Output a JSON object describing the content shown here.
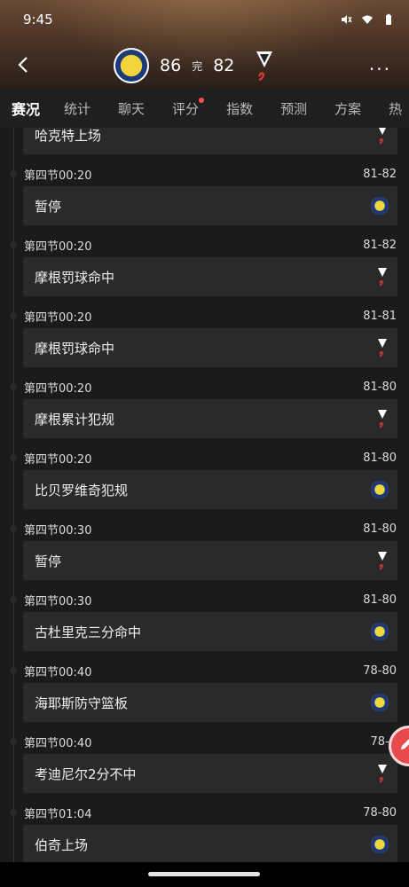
{
  "status_bar": {
    "time": "9:45",
    "icons": [
      "mute-icon",
      "wifi-icon",
      "battery-icon"
    ]
  },
  "header": {
    "home_score": "86",
    "status": "完",
    "away_score": "82",
    "more": "···"
  },
  "tabs": [
    {
      "label": "赛况",
      "active": true
    },
    {
      "label": "统计",
      "active": false
    },
    {
      "label": "聊天",
      "active": false
    },
    {
      "label": "评分",
      "active": false,
      "dot": true
    },
    {
      "label": "指数",
      "active": false
    },
    {
      "label": "预测",
      "active": false
    },
    {
      "label": "方案",
      "active": false
    },
    {
      "label": "热",
      "active": false
    }
  ],
  "events": [
    {
      "meta": "",
      "score": "",
      "text": "哈克特上场",
      "team": "away"
    },
    {
      "meta": "第四节00:20",
      "score": "81-82",
      "text": "暂停",
      "team": "home"
    },
    {
      "meta": "第四节00:20",
      "score": "81-82",
      "text": "摩根罚球命中",
      "team": "away"
    },
    {
      "meta": "第四节00:20",
      "score": "81-81",
      "text": "摩根罚球命中",
      "team": "away"
    },
    {
      "meta": "第四节00:20",
      "score": "81-80",
      "text": "摩根累计犯规",
      "team": "away"
    },
    {
      "meta": "第四节00:20",
      "score": "81-80",
      "text": "比贝罗维奇犯规",
      "team": "home"
    },
    {
      "meta": "第四节00:30",
      "score": "81-80",
      "text": "暂停",
      "team": "away"
    },
    {
      "meta": "第四节00:30",
      "score": "81-80",
      "text": "古杜里克三分命中",
      "team": "home"
    },
    {
      "meta": "第四节00:40",
      "score": "78-80",
      "text": "海耶斯防守篮板",
      "team": "home"
    },
    {
      "meta": "第四节00:40",
      "score": "78-8",
      "text": "考迪尼尔2分不中",
      "team": "away"
    },
    {
      "meta": "第四节01:04",
      "score": "78-80",
      "text": "伯奇上场",
      "team": "home"
    }
  ],
  "colors": {
    "accent": "#e64a4a",
    "card": "#2a2a2c",
    "background": "#1b1b1d"
  }
}
